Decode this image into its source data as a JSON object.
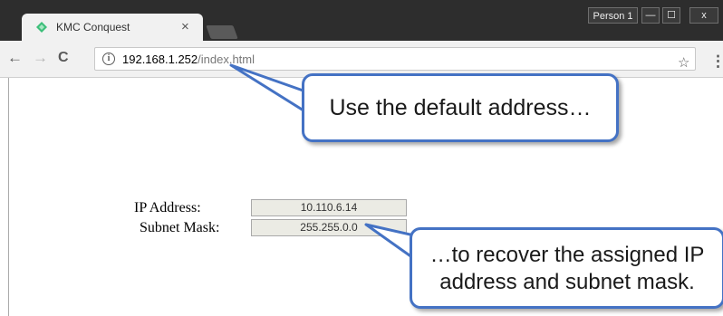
{
  "browser": {
    "profile_label": "Person 1",
    "window_controls": {
      "minimize": "—",
      "maximize": "☐",
      "close": "x"
    },
    "tab": {
      "title": "KMC Conquest",
      "close_symbol": "×"
    },
    "nav": {
      "back": "←",
      "forward": "→",
      "reload": "C"
    },
    "address_bar": {
      "info_symbol": "i",
      "host": "192.168.1.252",
      "path": "/index.html"
    },
    "star_symbol": "☆",
    "menu_symbol": "⋮"
  },
  "page": {
    "ip_address_label": "IP Address:",
    "ip_address_value": "10.110.6.14",
    "subnet_mask_label": "Subnet Mask:",
    "subnet_mask_value": "255.255.0.0"
  },
  "callouts": {
    "top_text": "Use the default address…",
    "bottom_text_line1": "…to recover the assigned IP",
    "bottom_text_line2": "address and subnet mask."
  },
  "colors": {
    "callout_border": "#4472c4",
    "favicon": "#3dbf7a",
    "titlebar": "#2d2d2d"
  }
}
